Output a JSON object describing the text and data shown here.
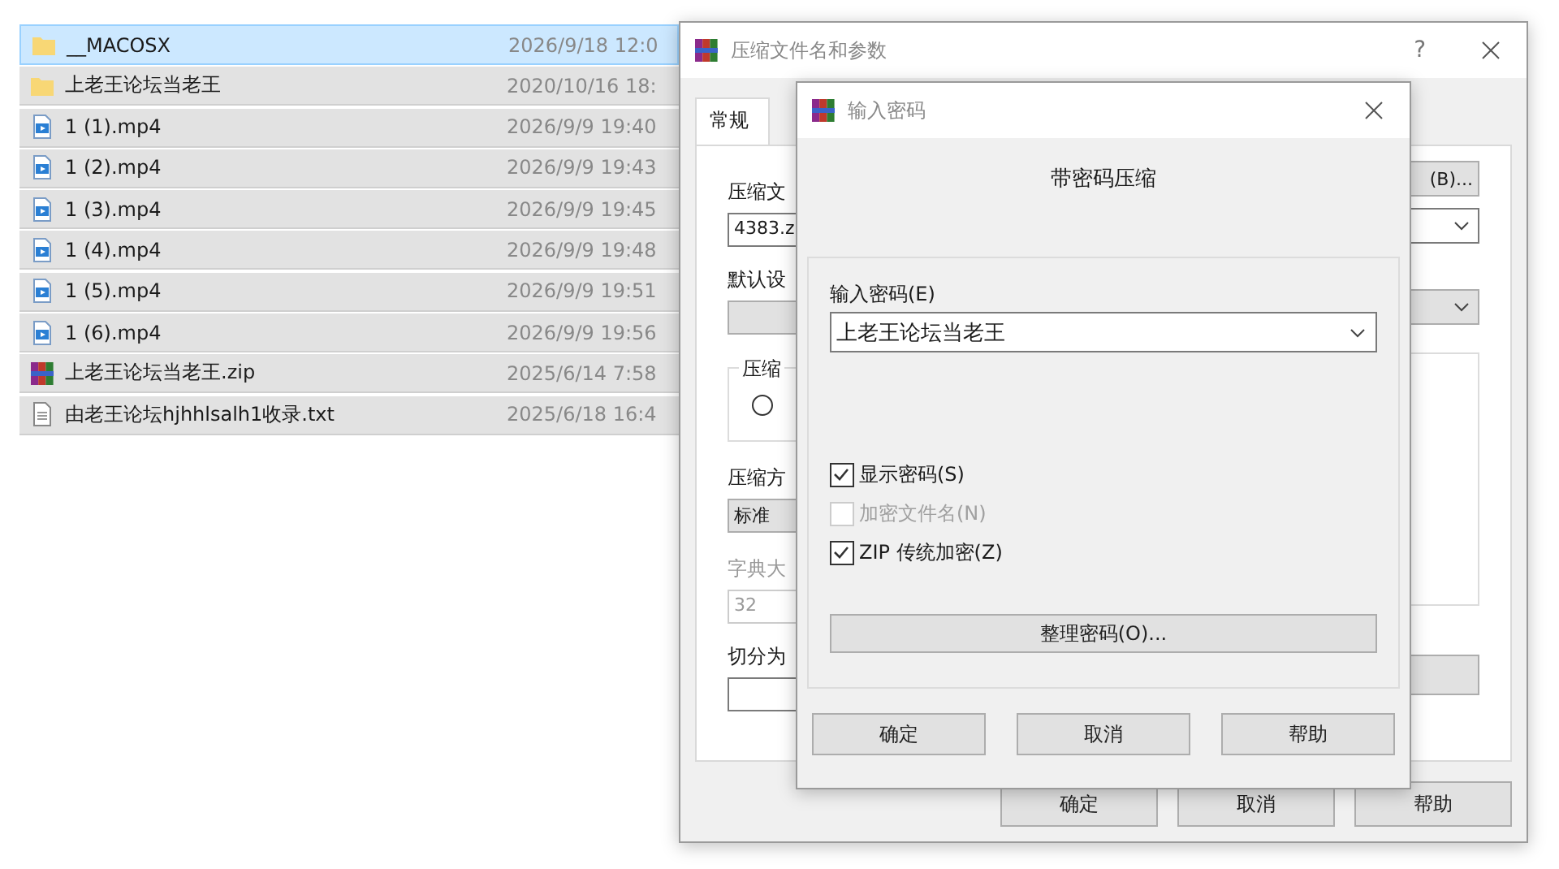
{
  "file_list": {
    "rows": [
      {
        "kind": "folder",
        "name": "__MACOSX",
        "date": "2026/9/18 12:0",
        "selected": true,
        "focused": true
      },
      {
        "kind": "folder",
        "name": "上老王论坛当老王",
        "date": "2020/10/16 18:",
        "selected": true,
        "focused": false
      },
      {
        "kind": "video",
        "name": "1 (1).mp4",
        "date": "2026/9/9 19:40",
        "selected": true,
        "focused": false
      },
      {
        "kind": "video",
        "name": "1 (2).mp4",
        "date": "2026/9/9 19:43",
        "selected": true,
        "focused": false
      },
      {
        "kind": "video",
        "name": "1 (3).mp4",
        "date": "2026/9/9 19:45",
        "selected": true,
        "focused": false
      },
      {
        "kind": "video",
        "name": "1 (4).mp4",
        "date": "2026/9/9 19:48",
        "selected": true,
        "focused": false
      },
      {
        "kind": "video",
        "name": "1 (5).mp4",
        "date": "2026/9/9 19:51",
        "selected": true,
        "focused": false
      },
      {
        "kind": "video",
        "name": "1 (6).mp4",
        "date": "2026/9/9 19:56",
        "selected": true,
        "focused": false
      },
      {
        "kind": "archive",
        "name": "上老王论坛当老王.zip",
        "date": "2025/6/14 7:58",
        "selected": true,
        "focused": false
      },
      {
        "kind": "text",
        "name": "由老王论坛hjhhlsalh1收录.txt",
        "date": "2025/6/18 16:4",
        "selected": true,
        "focused": false
      }
    ]
  },
  "archive_dialog": {
    "title": "压缩文件名和参数",
    "help": "?",
    "tabs": [
      {
        "label": "常规",
        "selected": true
      }
    ],
    "filename": {
      "label": "压缩文",
      "value": "4383.z"
    },
    "browse_button": "(B)...",
    "profile": {
      "label": "默认设"
    },
    "group": {
      "label": "压缩",
      "radio_selected": false
    },
    "method": {
      "label": "压缩方",
      "value": "标准"
    },
    "dictionary": {
      "label": "字典大",
      "value": "32",
      "disabled": true
    },
    "split": {
      "label": "切分为"
    },
    "buttons": [
      "确定",
      "取消",
      "帮助"
    ]
  },
  "password_dialog": {
    "title": "输入密码",
    "heading": "带密码压缩",
    "password": {
      "label": "输入密码(E)",
      "value": "上老王论坛当老王"
    },
    "options": [
      {
        "label": "显示密码(S)",
        "checked": true,
        "disabled": false
      },
      {
        "label": "加密文件名(N)",
        "checked": false,
        "disabled": true
      },
      {
        "label": "ZIP 传统加密(Z)",
        "checked": true,
        "disabled": false
      }
    ],
    "organize_button": "整理密码(O)...",
    "buttons": [
      "确定",
      "取消",
      "帮助"
    ]
  }
}
